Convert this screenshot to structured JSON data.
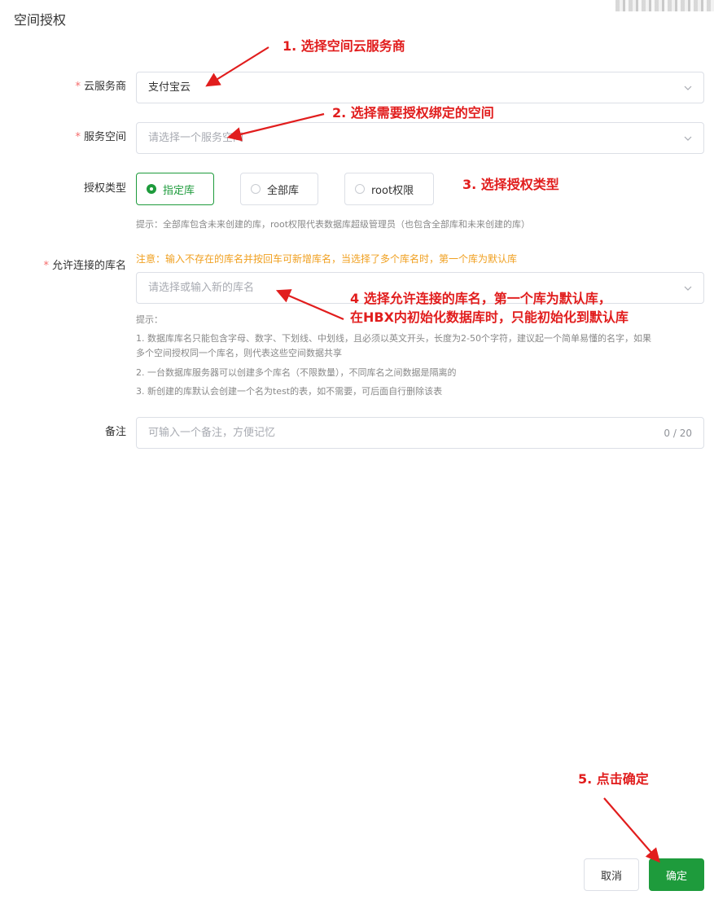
{
  "dialog": {
    "title": "空间授权"
  },
  "form": {
    "required_mark": "*",
    "provider": {
      "label": "云服务商",
      "value": "支付宝云"
    },
    "space": {
      "label": "服务空间",
      "placeholder": "请选择一个服务空间"
    },
    "auth_type": {
      "label": "授权类型",
      "options": [
        "指定库",
        "全部库",
        "root权限"
      ],
      "selected": "指定库",
      "hint": "提示：全部库包含未来创建的库，root权限代表数据库超级管理员（也包含全部库和未来创建的库）"
    },
    "db": {
      "label": "允许连接的库名",
      "warning": "注意：输入不存在的库名并按回车可新增库名，当选择了多个库名时，第一个库为默认库",
      "placeholder": "请选择或输入新的库名",
      "tips_title": "提示：",
      "tips": [
        "1. 数据库库名只能包含字母、数字、下划线、中划线，且必须以英文开头，长度为2-50个字符，建议起一个简单易懂的名字，如果",
        "多个空间授权同一个库名，则代表这些空间数据共享",
        "2. 一台数据库服务器可以创建多个库名（不限数量），不同库名之间数据是隔离的",
        "3. 新创建的库默认会创建一个名为test的表，如不需要，可后面自行删除该表"
      ]
    },
    "remark": {
      "label": "备注",
      "placeholder": "可输入一个备注，方便记忆",
      "counter": "0 / 20"
    }
  },
  "footer": {
    "cancel_label": "取消",
    "ok_label": "确定"
  },
  "annotations": {
    "step1": "1. 选择空间云服务商",
    "step2": "2. 选择需要授权绑定的空间",
    "step3": "3. 选择授权类型",
    "step4_line1": "4 选择允许连接的库名，第一个库为默认库，",
    "step4_line2": "在HBX内初始化数据库时，只能初始化到默认库",
    "step5": "5. 点击确定"
  },
  "colors": {
    "accent": "#1e9b3c",
    "annotation": "#e11d1d",
    "warning": "#f0a020",
    "required": "#f56c6c"
  }
}
